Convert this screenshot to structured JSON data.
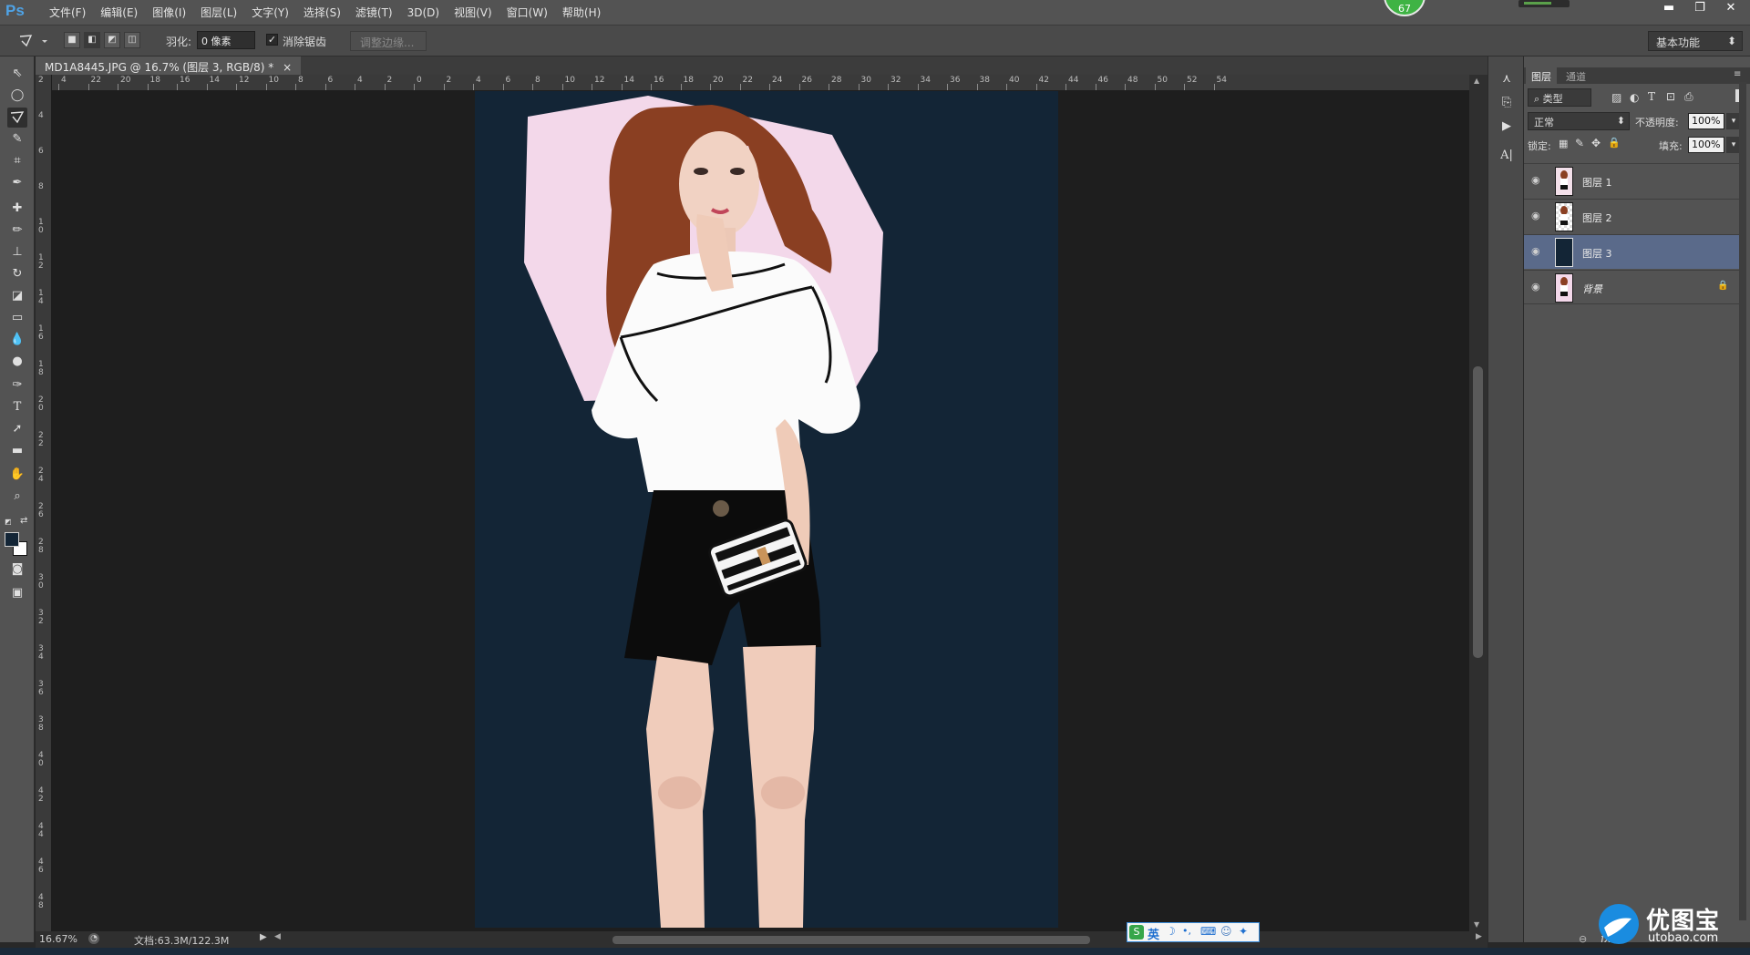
{
  "app": {
    "logo": "Ps",
    "badge_value": "67"
  },
  "menu": [
    "文件(F)",
    "编辑(E)",
    "图像(I)",
    "图层(L)",
    "文字(Y)",
    "选择(S)",
    "滤镜(T)",
    "3D(D)",
    "视图(V)",
    "窗口(W)",
    "帮助(H)"
  ],
  "window_controls": {
    "minimize": "▬",
    "restore": "❐",
    "close": "✕"
  },
  "options": {
    "feather_label": "羽化:",
    "feather_value": "0 像素",
    "antialias_label": "消除锯齿",
    "refine_edge_label": "调整边缘...",
    "workspace": "基本功能"
  },
  "document": {
    "tab_title": "MD1A8445.JPG @ 16.7% (图层 3, RGB/8) *",
    "close": "×"
  },
  "ruler": {
    "h_labels": [
      "4",
      "22",
      "20",
      "18",
      "16",
      "14",
      "12",
      "10",
      "8",
      "6",
      "4",
      "2",
      "0",
      "2",
      "4",
      "6",
      "8",
      "10",
      "12",
      "14",
      "16",
      "18",
      "20",
      "22",
      "24",
      "26",
      "28",
      "30",
      "32",
      "34",
      "36",
      "38",
      "40",
      "42",
      "44",
      "46",
      "48",
      "50",
      "52",
      "54"
    ],
    "v_labels": [
      "2",
      "4",
      "6",
      "8",
      "1\n0",
      "1\n2",
      "1\n4",
      "1\n6",
      "1\n8",
      "2\n0",
      "2\n2",
      "2\n4",
      "2\n6",
      "2\n8",
      "3\n0",
      "3\n2",
      "3\n4",
      "3\n6",
      "3\n8",
      "4\n0",
      "4\n2",
      "4\n4",
      "4\n6",
      "4\n8"
    ]
  },
  "status": {
    "zoom": "16.67%",
    "doc_size": "文档:63.3M/122.3M"
  },
  "ime": {
    "label": "英"
  },
  "panels": {
    "tabs": [
      "图层",
      "通道"
    ],
    "filter_kind": "类型",
    "blend_mode": "正常",
    "opacity_label": "不透明度:",
    "opacity_value": "100%",
    "lock_label": "锁定:",
    "fill_label": "填充:",
    "fill_value": "100%",
    "layers": [
      {
        "name": "图层 1",
        "thumb": "model",
        "selected": false,
        "locked": false
      },
      {
        "name": "图层 2",
        "thumb": "model",
        "selected": false,
        "locked": false
      },
      {
        "name": "图层 3",
        "thumb": "navy",
        "selected": true,
        "locked": false
      },
      {
        "name": "背景",
        "thumb": "model",
        "selected": false,
        "locked": true
      }
    ],
    "footer": {
      "link": "⊖",
      "fx": "fx."
    }
  },
  "watermark": {
    "brand": "优图宝",
    "url": "utobao.com"
  },
  "colors": {
    "accent": "#4fa3e6",
    "canvas_bg": "#132536",
    "pink_bg": "#f3d8ea",
    "selected_layer": "#5a6a8a"
  }
}
